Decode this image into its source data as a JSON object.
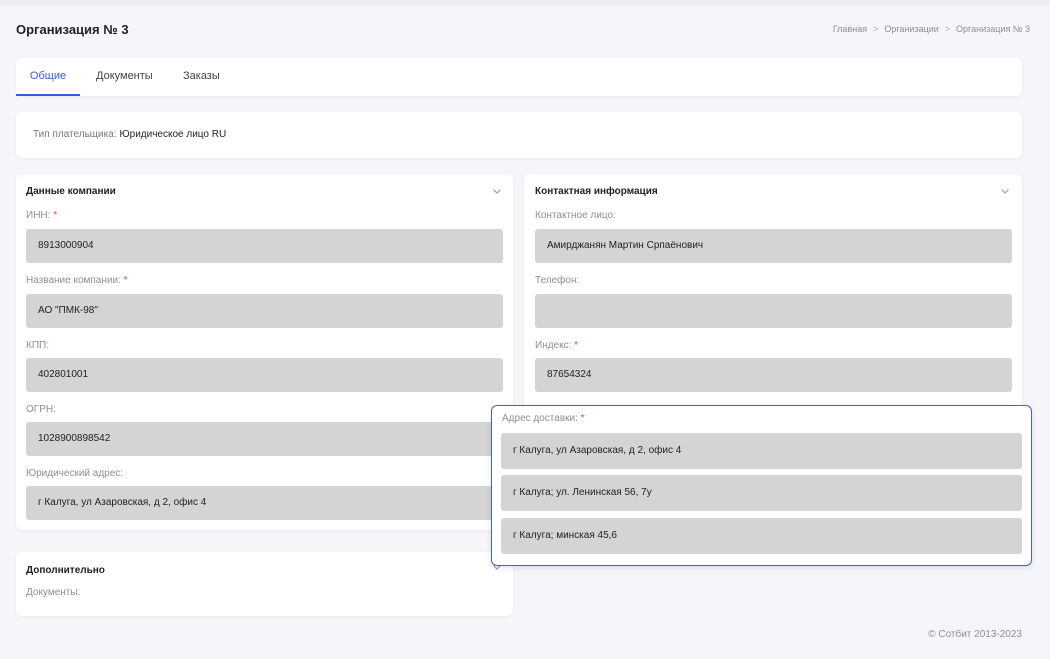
{
  "page": {
    "title": "Организация № 3",
    "breadcrumb": [
      "Главная",
      "Организации",
      "Организация № 3"
    ],
    "breadcrumb_sep": ">"
  },
  "tabs": [
    {
      "label": "Общие",
      "active": true
    },
    {
      "label": "Документы",
      "active": false
    },
    {
      "label": "Заказы",
      "active": false
    }
  ],
  "payer": {
    "label": "Тип плательщика:",
    "value": "Юридическое лицо RU"
  },
  "company": {
    "title": "Данные компании",
    "fields": [
      {
        "label": "ИНН:",
        "required": "*",
        "value": "8913000904"
      },
      {
        "label": "Название компании:",
        "required": "*",
        "value": "АО \"ПМК-98\""
      },
      {
        "label": "КПП:",
        "required": "",
        "value": "402801001"
      },
      {
        "label": "ОГРН:",
        "required": "",
        "value": "1028900898542"
      },
      {
        "label": "Юридический адрес:",
        "required": "",
        "value": "г Калуга, ул Азаровская, д 2, офис 4"
      }
    ]
  },
  "contact": {
    "title": "Контактная информация",
    "fields": [
      {
        "label": "Контактное лицо:",
        "required": "",
        "value": "Амирджанян Мартин Српаёнович"
      },
      {
        "label": "Телефон:",
        "required": "",
        "value": ""
      },
      {
        "label": "Индекс:",
        "required": "*",
        "value": "87654324"
      }
    ]
  },
  "delivery": {
    "label": "Адрес доставки:",
    "required": "*",
    "options": [
      "г Калуга, ул Азаровская, д 2, офис 4",
      "г Калуга; ул. Ленинская 56, 7у",
      "г Калуга; минская 45,6"
    ]
  },
  "extra": {
    "title": "Дополнительно",
    "documents_label": "Документы:"
  },
  "footer": {
    "copyright": "© Сотбит 2013-2023"
  },
  "icons": {
    "chevron": "chevron-down-icon"
  },
  "colors": {
    "accent": "#3b5bdb",
    "required": "#e0485a",
    "field_bg": "#d4d4d4",
    "dropdown_border": "#4a63b8"
  }
}
